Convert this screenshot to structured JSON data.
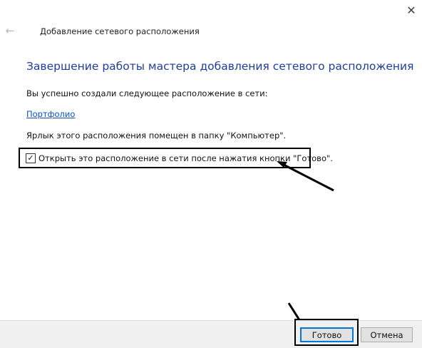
{
  "window": {
    "title": "Добавление сетевого расположения",
    "close_glyph": "✕",
    "back_glyph": "←"
  },
  "content": {
    "heading": "Завершение работы мастера добавления сетевого расположения",
    "success_text": "Вы успешно создали следующее расположение в сети:",
    "location_link": "Портфолио",
    "shortcut_text": "Ярлык этого расположения помещен в папку \"Компьютер\".",
    "checkbox": {
      "label": "Открыть это расположение в сети после нажатия кнопки \"Готово\".",
      "checked": true,
      "check_glyph": "✓"
    }
  },
  "footer": {
    "finish_label": "Готово",
    "cancel_label": "Отмена"
  },
  "icons": {
    "close": "close-icon",
    "back": "back-arrow-icon",
    "check": "checkmark-icon"
  },
  "colors": {
    "heading": "#1e3e9b",
    "link": "#0a4fc1",
    "footer_bg": "#f0f0f0",
    "default_button_border": "#0078d7",
    "annotation": "#000000"
  }
}
